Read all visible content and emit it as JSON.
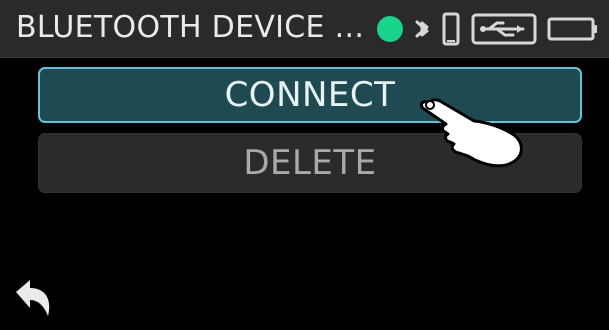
{
  "header": {
    "title": "BLUETOOTH DEVICE ...",
    "status_icons": {
      "connected_indicator": "green-dot",
      "bluetooth": "bluetooth-icon",
      "phone": "phone-icon",
      "usb": "usb-icon",
      "battery": "battery-icon"
    }
  },
  "menu": {
    "connect_label": "CONNECT",
    "delete_label": "DELETE"
  },
  "colors": {
    "status_green": "#19d38a",
    "connect_bg": "#1f4a52",
    "connect_border": "#69c0d4",
    "delete_bg": "#2b2b2b"
  }
}
